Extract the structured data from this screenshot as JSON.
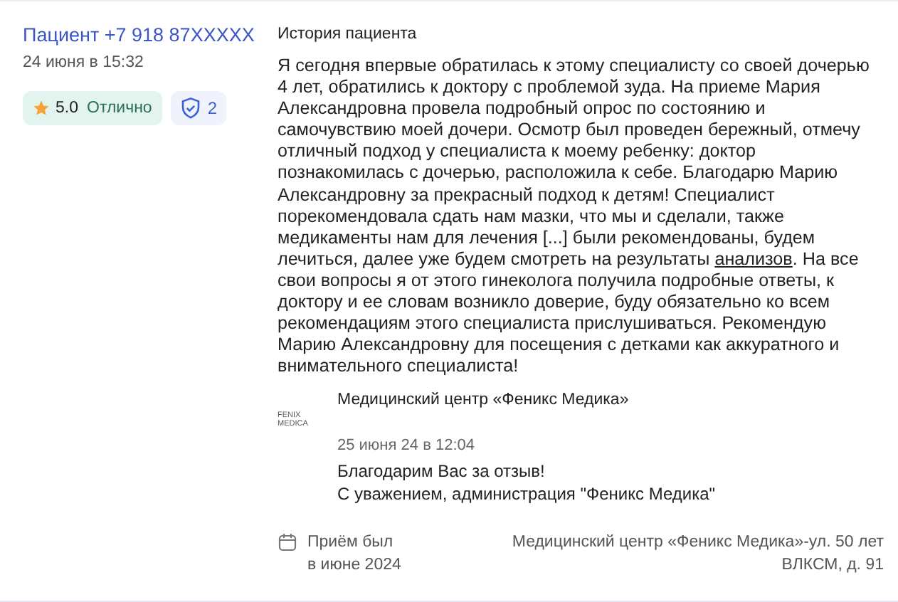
{
  "author": {
    "name": "Пациент +7 918 87XXXXX",
    "date": "24 июня в 15:32"
  },
  "rating": {
    "score": "5.0",
    "label": "Отлично"
  },
  "verified": {
    "count": "2"
  },
  "review": {
    "heading": "История пациента",
    "text_before": "Я сегодня впервые обратилась к этому специалисту со своей дочерью 4 лет, обратились к доктору с проблемой зуда. На приеме Мария Александровна провела подробный опрос по состоянию и самочувствию моей дочери. Осмотр был проведен бережный, отмечу отличный подход у специалиста к моему ребенку: доктор познакомилась с дочерью, расположила к себе. Благодарю Марию Александровну за прекрасный подход к детям! Специалист порекомендовала сдать нам мазки, что мы и сделали, также медикаменты нам для лечения [...] были рекомендованы, будем лечиться, далее уже будем смотреть на результаты",
    "link": "анализов",
    "text_after": ". На все свои вопросы я от этого гинеколога получила подробные ответы, к доктору и ее словам возникло доверие, буду обязательно ко всем рекомендациям этого специалиста прислушиваться. Рекомендую Марию Александровну для посещения с детками как аккуратного и внимательного специалиста!"
  },
  "reply": {
    "logo_lines": [
      "FENIX",
      "MEDICA"
    ],
    "clinic": "Медицинский центр «Феникс Медика»",
    "date": "25 июня 24 в 12:04",
    "lines": [
      "Благодарим Вас за отзыв!",
      "С уважением, администрация \"Феникс Медика\""
    ]
  },
  "visit": {
    "lines": [
      "Приём был",
      "в июне 2024"
    ],
    "address": "Медицинский центр «Феникс Медика»-ул. 50 лет ВЛКСМ, д. 91"
  }
}
